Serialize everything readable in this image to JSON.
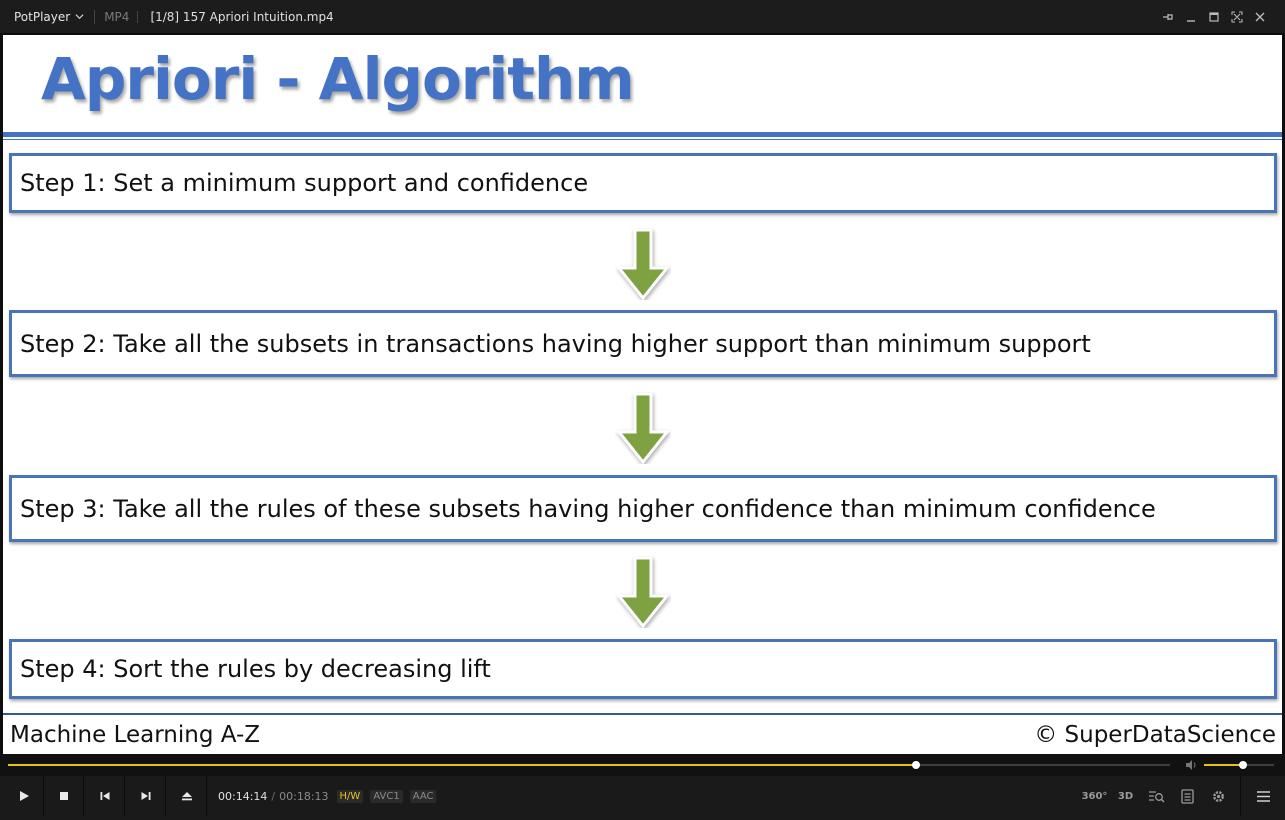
{
  "window": {
    "app_name": "PotPlayer",
    "format": "MP4",
    "file_title": "[1/8] 157 Apriori Intuition.mp4"
  },
  "slide": {
    "title": "Apriori - Algorithm",
    "steps": [
      "Step 1: Set a minimum support and confidence",
      "Step 2: Take all the subsets in transactions having higher support than minimum support",
      "Step 3: Take all the rules of these subsets having higher confidence than minimum confidence",
      "Step 4: Sort the rules by decreasing lift"
    ],
    "footer_left": "Machine Learning A-Z",
    "footer_right": "© SuperDataScience"
  },
  "player": {
    "current_time": "00:14:14",
    "duration": "00:18:13",
    "progress": 0.781,
    "volume": 0.55,
    "badges": {
      "hw": "H/W",
      "video_codec": "AVC1",
      "audio_codec": "AAC"
    },
    "icons": {
      "play": "play-icon",
      "stop": "stop-icon",
      "prev": "previous-icon",
      "next": "next-icon",
      "eject": "eject-icon",
      "vr": "360-icon",
      "stereo": "3d-icon",
      "zoom": "zoom-icon",
      "playlist": "playlist-icon",
      "settings": "gear-icon",
      "menu": "hamburger-menu-icon"
    },
    "labels": {
      "vr": "360°",
      "stereo": "3D"
    }
  },
  "colors": {
    "accent": "#e8c21a",
    "slide_blue": "#4472c4",
    "arrow_green": "#7ea242"
  }
}
